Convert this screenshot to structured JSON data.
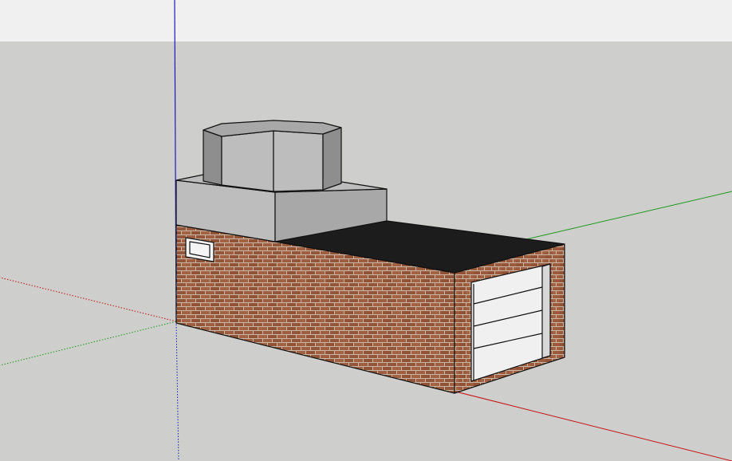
{
  "viewport": {
    "sky_color": "#f0f0f0",
    "ground_color": "#cececc"
  },
  "axes": {
    "red_axis_color": "#c41414",
    "green_axis_color": "#1f9a1f",
    "blue_axis_color": "#1a1ab8"
  },
  "model": {
    "brick_color": "#9a5a3c",
    "mortar_color": "#c9b7a6",
    "roof_color": "#1c1c1c",
    "concrete_light": "#bdbdbd",
    "concrete_mid": "#a8a8a8",
    "concrete_dark": "#8e8e8e",
    "garage_door_color": "#f0f0f0",
    "window_color": "#f4f4f4",
    "edge_color": "#111111"
  }
}
